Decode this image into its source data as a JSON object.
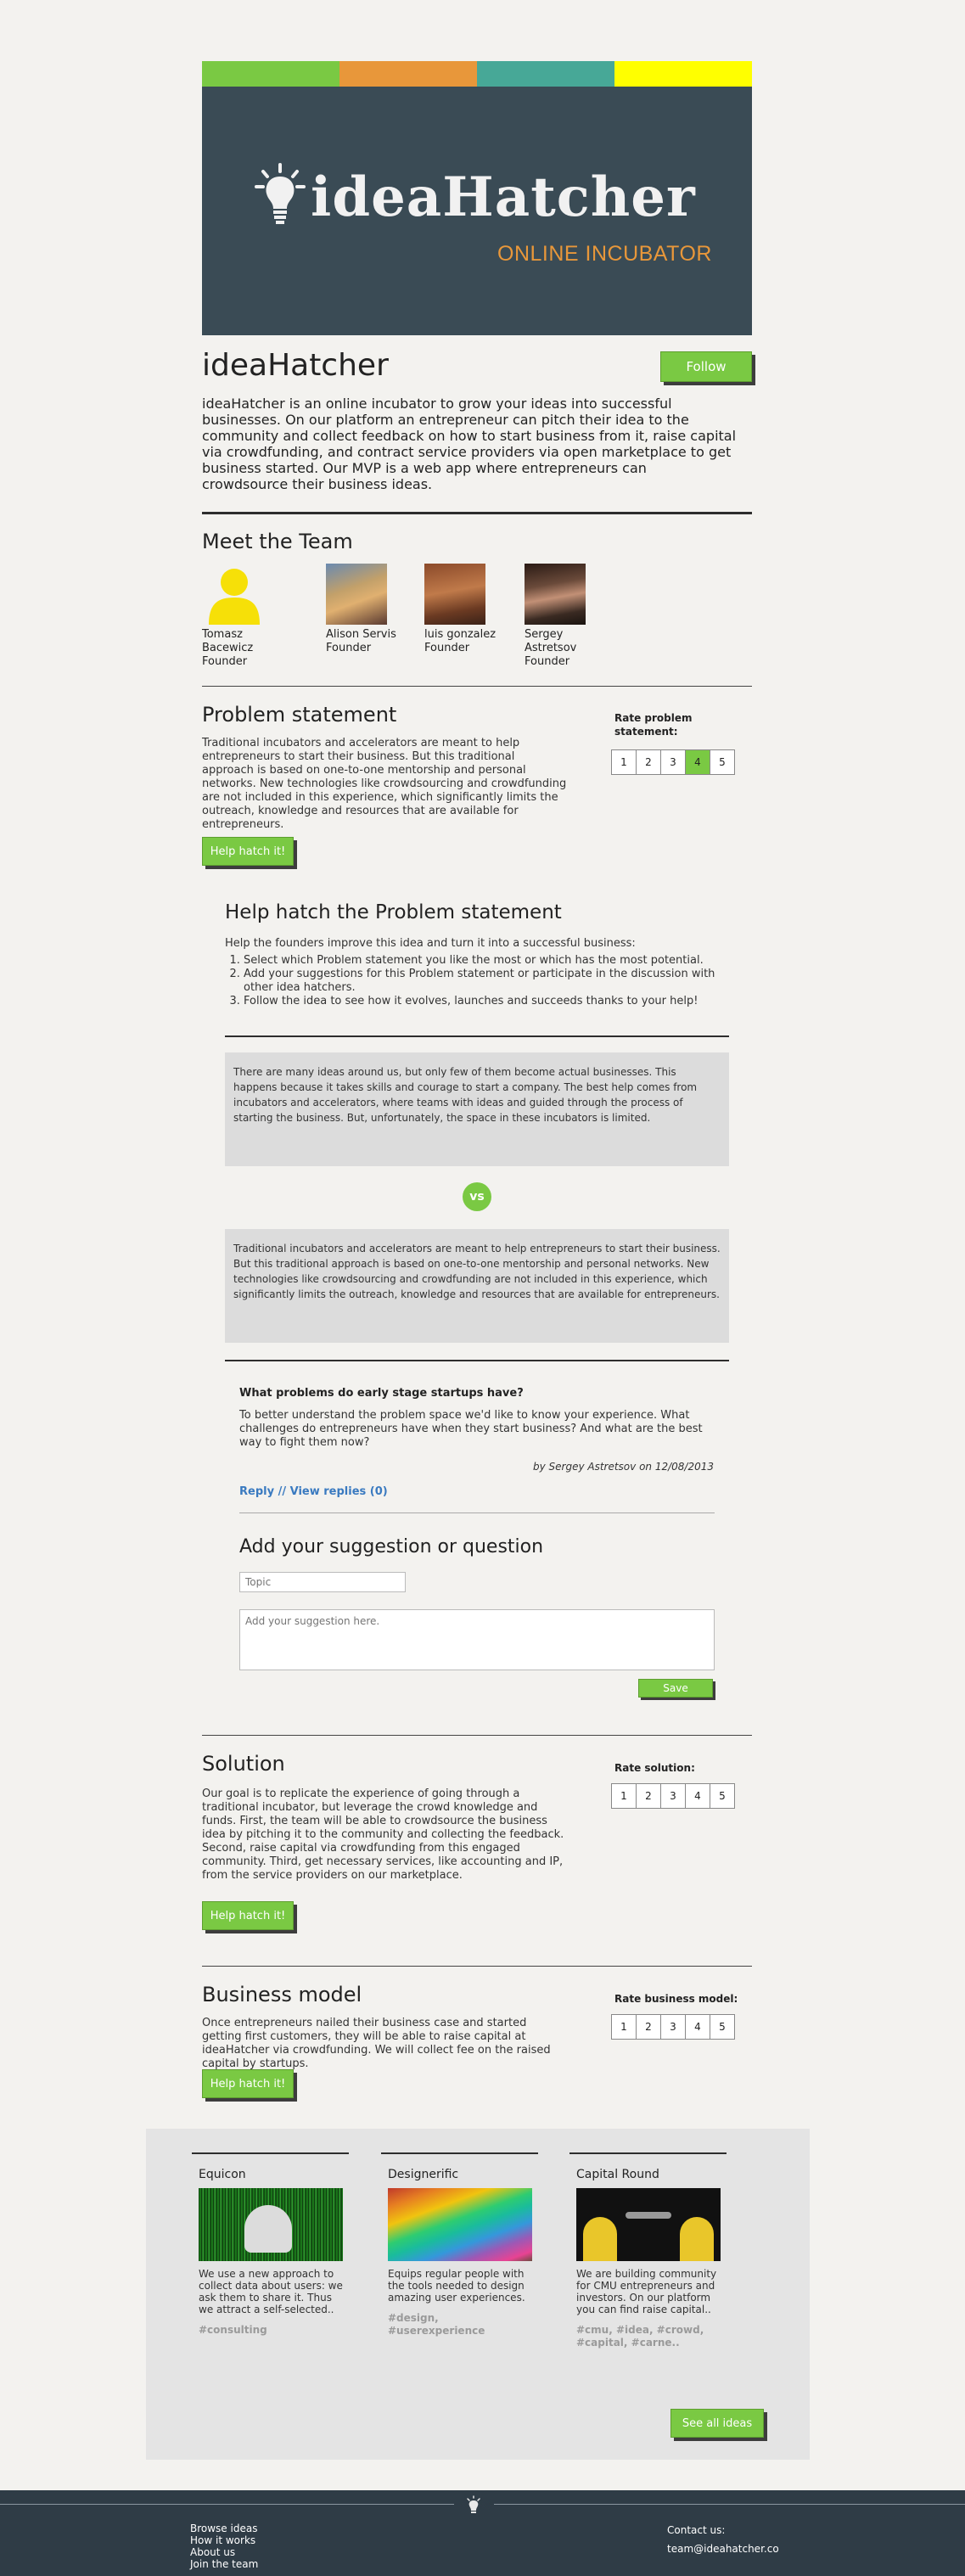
{
  "header": {
    "stripe_colors": [
      "#7ac943",
      "#e8973a",
      "#47a897",
      "#ffff00"
    ],
    "banner_bg": "#3a4b55",
    "logo_text": "ideaHatcher",
    "logo_tagline": "ONLINE INCUBATOR",
    "icon": "lightbulb-icon"
  },
  "project": {
    "title": "ideaHatcher",
    "follow_label": "Follow",
    "description": "ideaHatcher is an online incubator to grow your ideas into successful businesses. On our platform an entrepreneur can pitch their idea to the community and collect feedback on how to start business from it, raise capital via crowdfunding, and contract service providers via open marketplace to get business started. Our MVP is a web app where entrepreneurs can crowdsource their business ideas."
  },
  "team": {
    "heading": "Meet the Team",
    "members": [
      {
        "name": "Tomasz Bacewicz",
        "role": "Founder"
      },
      {
        "name": "Alison Servis",
        "role": "Founder"
      },
      {
        "name": "luis gonzalez",
        "role": "Founder"
      },
      {
        "name": "Sergey Astretsov",
        "role": "Founder"
      }
    ]
  },
  "problem": {
    "heading": "Problem statement",
    "text": "Traditional incubators and accelerators are meant to help entrepreneurs to start their business. But this traditional approach is based on one-to-one mentorship and personal networks. New technologies like crowdsourcing and crowdfunding are not included in this experience, which significantly limits the outreach, knowledge and resources that are available for entrepreneurs.",
    "rate_label": "Rate problem statement:",
    "rating_options": [
      "1",
      "2",
      "3",
      "4",
      "5"
    ],
    "selected_rating": 4,
    "hatch_label": "Help hatch it!"
  },
  "hatch_panel": {
    "heading": "Help hatch the Problem statement",
    "intro": "Help the founders improve this idea and turn it into a successful business:",
    "steps": [
      "Select which Problem statement you like the most or which has the most potential.",
      "Add your suggestions for this Problem statement or participate in the discussion with other idea hatchers.",
      "Follow the idea to see how it evolves, launches and succeeds thanks to your help!"
    ],
    "option_a": "There are many ideas around us, but only few of them become actual businesses. This happens because it takes skills and courage to start a company. The best help comes from incubators and accelerators, where teams with ideas and guided through the process of starting the business. But, unfortunately, the space in these incubators is limited.",
    "vs_label": "vs",
    "option_b": "Traditional incubators and accelerators are meant to help entrepreneurs to start their business. But this traditional approach is based on one-to-one mentorship and personal networks. New technologies like crowdsourcing and crowdfunding are not included in this experience, which significantly limits the outreach, knowledge and resources that are available for entrepreneurs.",
    "comment": {
      "title": "What problems do early stage startups have?",
      "body": "To better understand the problem space we'd like to know your experience. What challenges do entrepreneurs have when they start business? And what are the best way to fight them now?",
      "byline": "by Sergey Astretsov on 12/08/2013",
      "reply_link": "Reply // View replies (0)"
    },
    "suggestion": {
      "heading": "Add your suggestion or question",
      "topic_placeholder": "Topic",
      "body_placeholder": "Add your suggestion here.",
      "save_label": "Save"
    }
  },
  "solution": {
    "heading": "Solution",
    "text": "Our goal is to replicate the experience of going through a traditional incubator, but leverage the crowd knowledge and funds. First, the team will be able to crowdsource the business idea by pitching it to the community and collecting the feedback. Second, raise capital via crowdfunding from this engaged community. Third, get necessary services, like accounting and IP, from the service providers on our marketplace.",
    "rate_label": "Rate solution:",
    "rating_options": [
      "1",
      "2",
      "3",
      "4",
      "5"
    ],
    "hatch_label": "Help hatch it!"
  },
  "business_model": {
    "heading": "Business model",
    "text": "Once entrepreneurs nailed their business case and started getting first customers, they will be able to raise capital at ideaHatcher via crowdfunding. We will collect fee on the raised capital by startups.",
    "rate_label": "Rate business model:",
    "rating_options": [
      "1",
      "2",
      "3",
      "4",
      "5"
    ],
    "hatch_label": "Help hatch it!"
  },
  "related_ideas": {
    "cards": [
      {
        "title": "Equicon",
        "desc": "We use a new approach to collect data about users: we ask them to share it. Thus we attract a self-selected..",
        "tags": "#consulting"
      },
      {
        "title": "Designerific",
        "desc": "Equips regular people with the tools needed to design amazing user experiences.",
        "tags": "#design, #userexperience"
      },
      {
        "title": "Capital Round",
        "desc": "We are building community for CMU entrepreneurs and investors. On our platform you can find raise capital..",
        "tags": "#cmu, #idea, #crowd, #capital, #carne.."
      }
    ],
    "see_all_label": "See all ideas"
  },
  "footer": {
    "bg": "#2f3c46",
    "links": [
      "Browse ideas",
      "How it works",
      "About us",
      "Join the team"
    ],
    "contact_label": "Contact us:",
    "contact_email": "team@ideahatcher.co"
  }
}
